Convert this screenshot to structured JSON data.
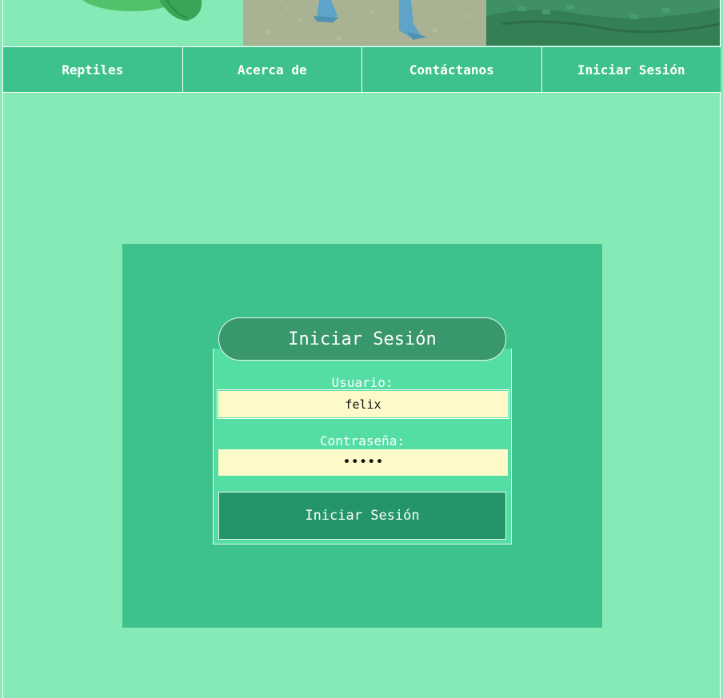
{
  "nav": {
    "items": [
      {
        "label": "Reptiles"
      },
      {
        "label": "Acerca de"
      },
      {
        "label": "Contáctanos"
      },
      {
        "label": "Iniciar Sesión"
      }
    ]
  },
  "login": {
    "title": "Iniciar Sesión",
    "username_label": "Usuario:",
    "username_value": "felix",
    "password_label": "Contraseña:",
    "password_value": "•••••",
    "submit_label": "Iniciar Sesión"
  },
  "colors": {
    "page_background": "#86eab6",
    "nav_background": "#3dc28b",
    "panel_background": "#3dc28b",
    "title_background": "#38976b",
    "form_background": "#55dea4",
    "input_background": "#fdf9c8",
    "button_background": "#239569"
  }
}
